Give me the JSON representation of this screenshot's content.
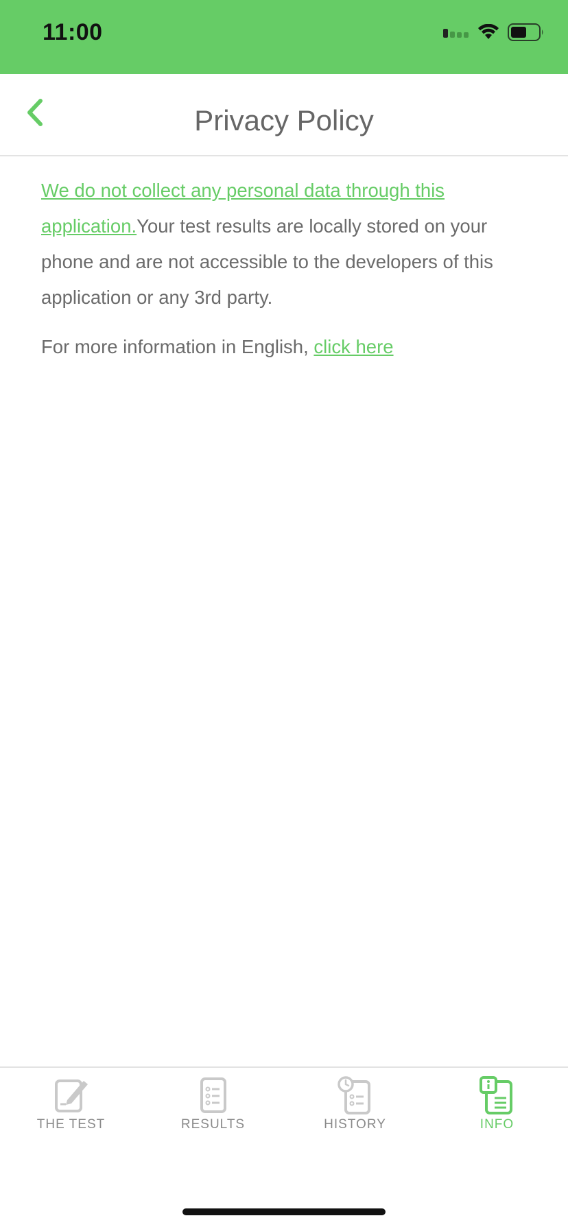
{
  "status_bar": {
    "time": "11:00",
    "background": "#66cc66"
  },
  "nav": {
    "title": "Privacy Policy",
    "back_icon": "chevron-left-icon"
  },
  "content": {
    "paragraph1_link": "We do not collect any personal data through this application.",
    "paragraph1_text": "Your test results are locally stored on your phone and are not accessible to the developers of this application or any 3rd party.",
    "paragraph2_text": "For more information in English, ",
    "paragraph2_link": "click here"
  },
  "tabs": [
    {
      "label": "THE TEST",
      "icon": "edit-note-icon",
      "active": false
    },
    {
      "label": "RESULTS",
      "icon": "checklist-icon",
      "active": false
    },
    {
      "label": "HISTORY",
      "icon": "history-clipboard-icon",
      "active": false
    },
    {
      "label": "INFO",
      "icon": "info-document-icon",
      "active": true
    }
  ],
  "colors": {
    "accent": "#66cc66",
    "text": "#6b6b6b",
    "inactive_tab": "#8a8a8a"
  }
}
